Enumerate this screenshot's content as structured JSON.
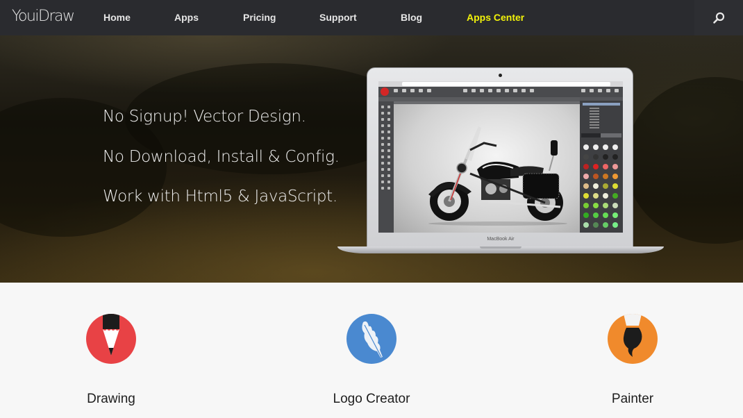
{
  "navbar": {
    "logo": "YouiDraw",
    "items": [
      {
        "label": "Home",
        "active": false
      },
      {
        "label": "Apps",
        "active": false
      },
      {
        "label": "Pricing",
        "active": false
      },
      {
        "label": "Support",
        "active": false
      },
      {
        "label": "Blog",
        "active": false
      },
      {
        "label": "Apps Center",
        "active": true
      }
    ],
    "search_icon": "search-icon",
    "active_color": "#f2f20a"
  },
  "hero": {
    "taglines": [
      "No Signup! Vector Design.",
      "No Download, Install & Config.",
      "Work with Html5 & JavaScript."
    ],
    "device_label": "MacBook Air",
    "screenshot_subject": "motorcycle vector illustration in drawing app"
  },
  "apps": [
    {
      "label": "Drawing",
      "icon": "pencil-icon",
      "color": "#e84245"
    },
    {
      "label": "Logo Creator",
      "icon": "feather-icon",
      "color": "#4a89d0"
    },
    {
      "label": "Painter",
      "icon": "paintbrush-icon",
      "color": "#f08a2c"
    }
  ]
}
